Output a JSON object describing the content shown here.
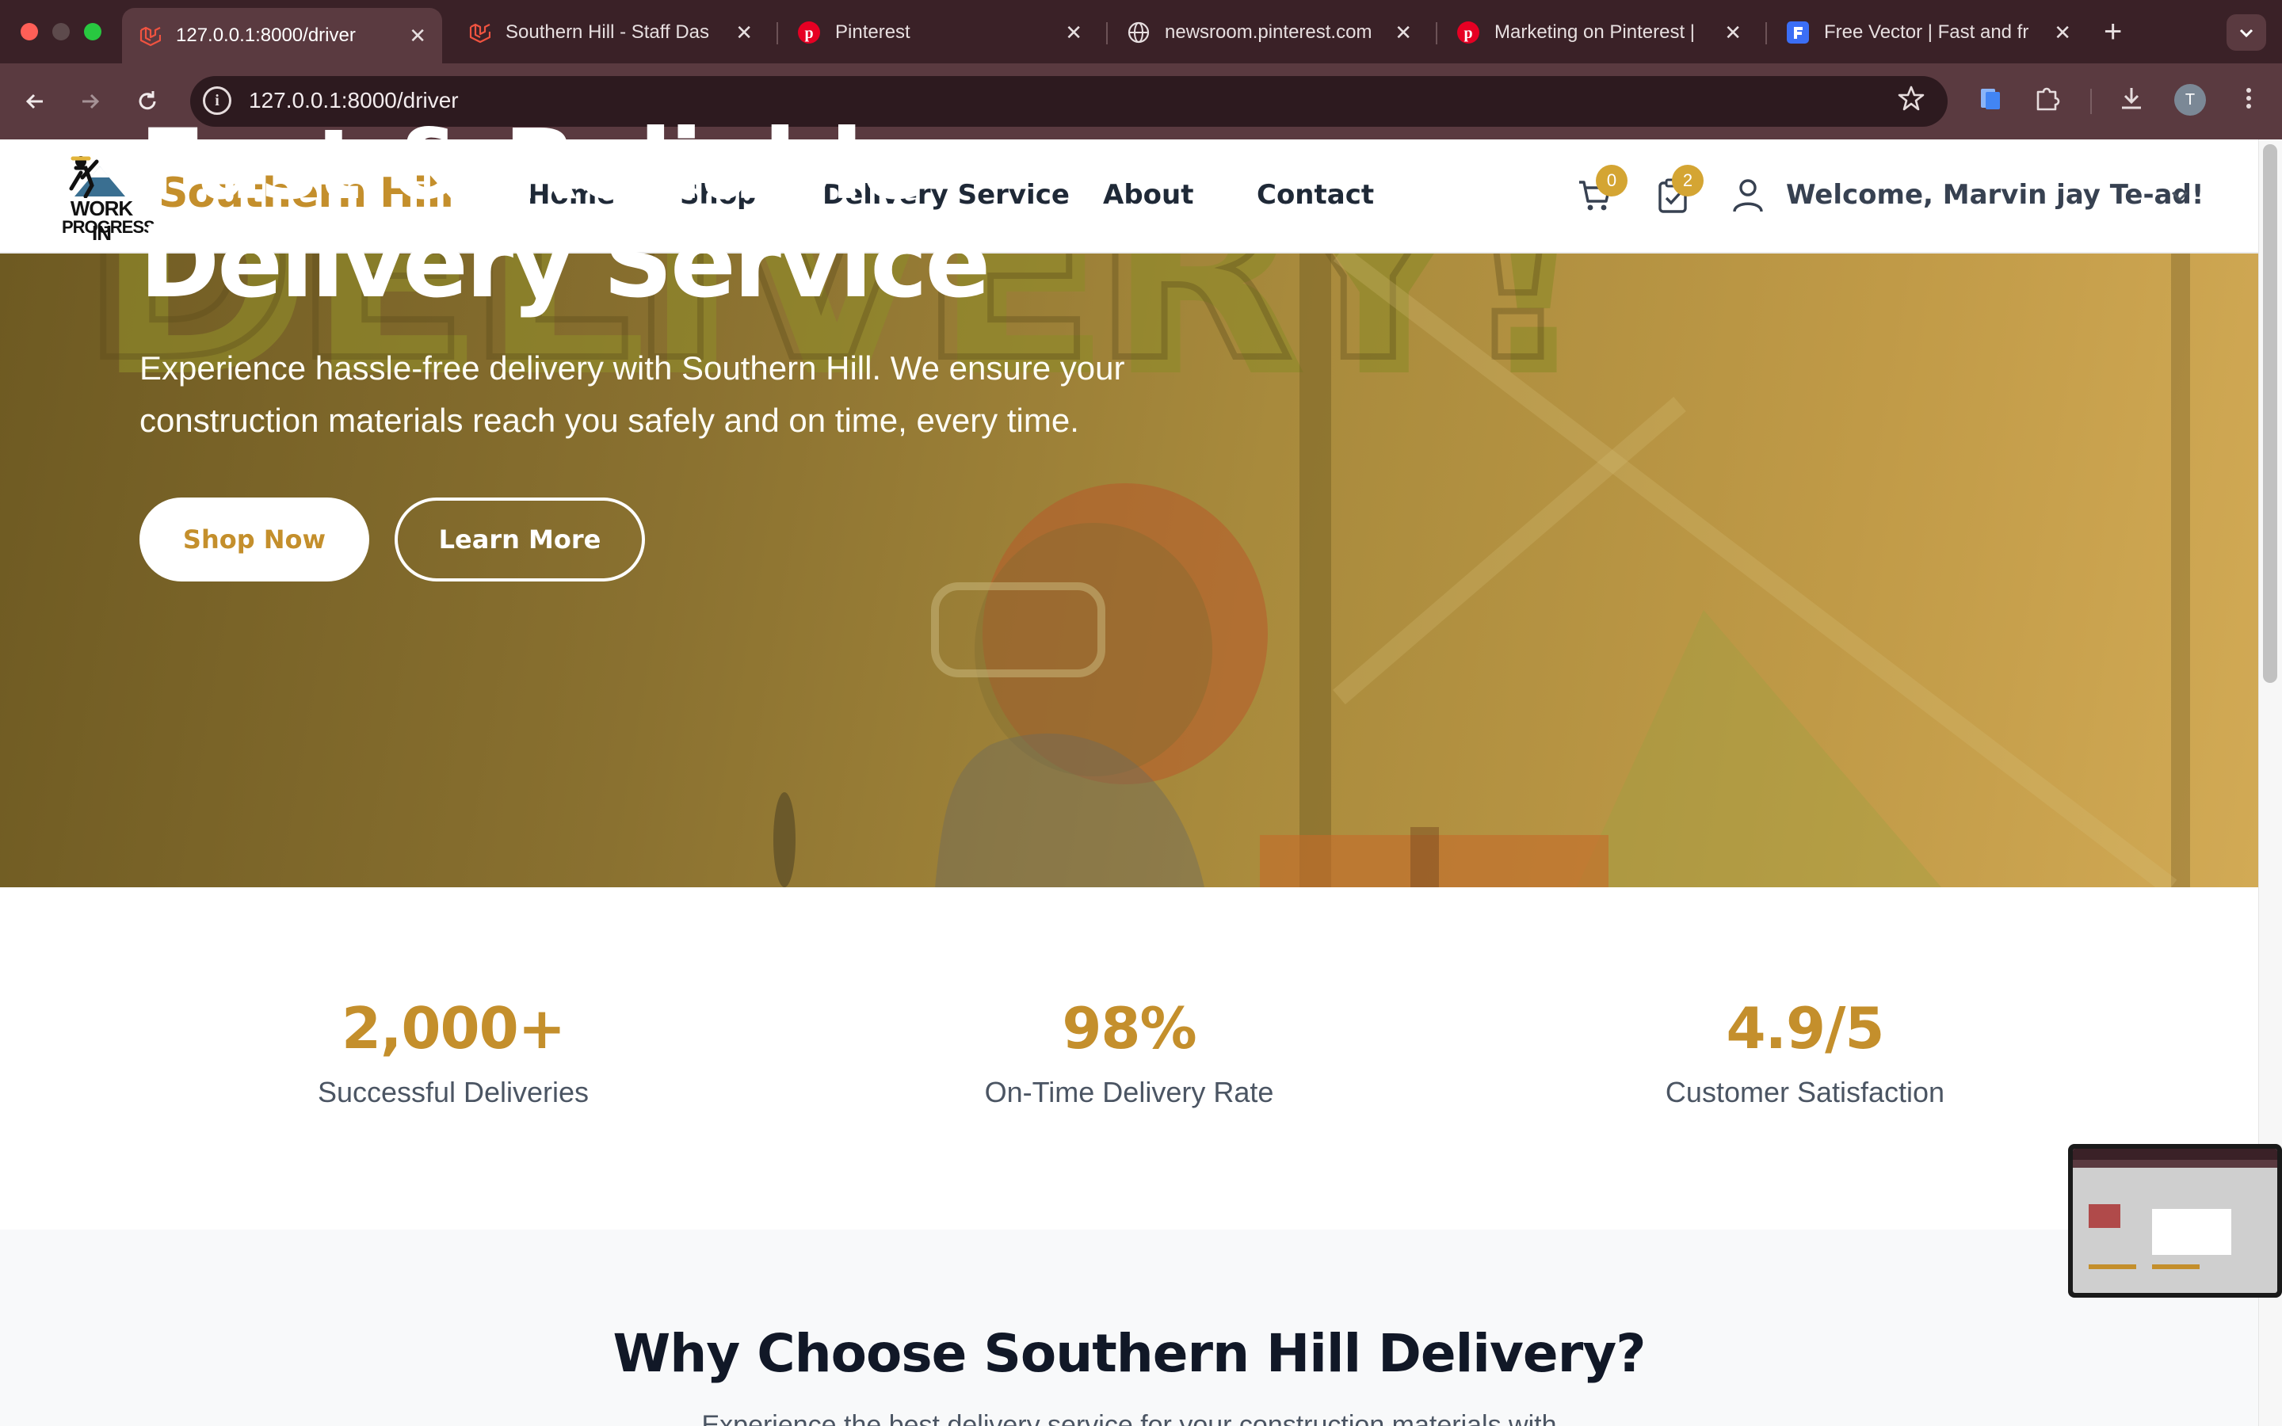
{
  "browser": {
    "tabs": [
      {
        "title": "127.0.0.1:8000/driver",
        "icon": "laravel-icon",
        "active": true
      },
      {
        "title": "Southern Hill - Staff Das",
        "icon": "laravel-icon",
        "active": false
      },
      {
        "title": "Pinterest",
        "icon": "pinterest-icon",
        "active": false
      },
      {
        "title": "newsroom.pinterest.com",
        "icon": "globe-icon",
        "active": false
      },
      {
        "title": "Marketing on Pinterest |",
        "icon": "pinterest-icon",
        "active": false
      },
      {
        "title": "Free Vector | Fast and fr",
        "icon": "freepik-icon",
        "active": false
      }
    ],
    "url": "127.0.0.1:8000/driver",
    "profile_initial": "T"
  },
  "site": {
    "logo_line1": "WORK IN",
    "logo_line2": "PROGRESS",
    "brand": "Southern Hill",
    "nav": [
      "Home",
      "Shop",
      "Delivery Service",
      "About",
      "Contact"
    ],
    "cart_count": "0",
    "orders_count": "2",
    "welcome": "Welcome, Marvin jay Te-ad!"
  },
  "hero": {
    "title_line1": "Fast & Reliable",
    "title_line2": "Delivery Service",
    "subtitle": "Experience hassle-free delivery with Southern Hill. We ensure your construction materials reach you safely and on time, every time.",
    "primary_button": "Shop Now",
    "secondary_button": "Learn More",
    "background_word": "DELIVERY!"
  },
  "stats": [
    {
      "value": "2,000+",
      "label": "Successful Deliveries"
    },
    {
      "value": "98%",
      "label": "On-Time Delivery Rate"
    },
    {
      "value": "4.9/5",
      "label": "Customer Satisfaction"
    }
  ],
  "why": {
    "title": "Why Choose Southern Hill Delivery?",
    "subtitle": "Experience the best delivery service for your construction materials with"
  },
  "colors": {
    "brand_gold": "#c48f2c",
    "badge": "#d4a533",
    "chrome_dark": "#3a2127",
    "chrome_toolbar": "#5a3a40"
  }
}
